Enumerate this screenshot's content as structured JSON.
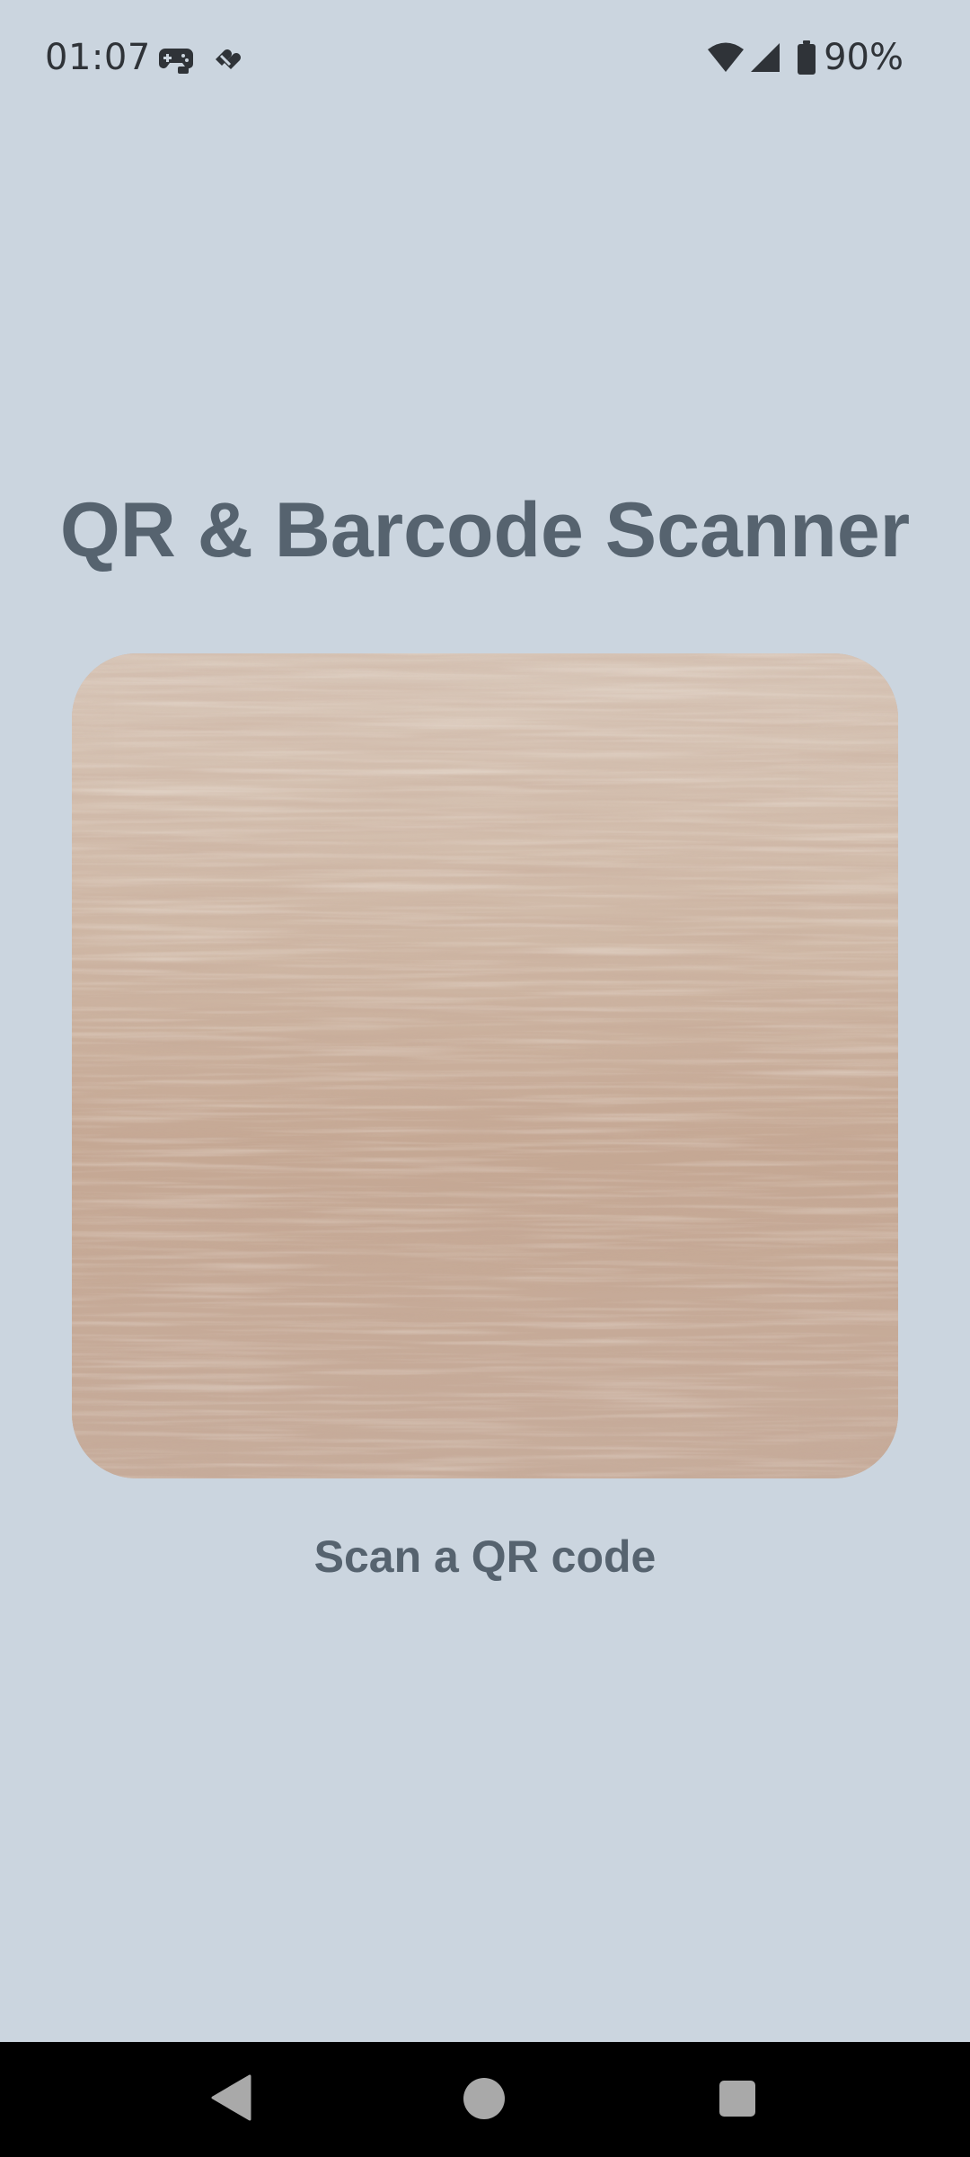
{
  "status_bar": {
    "time": "01:07",
    "notification_icons": [
      "game-controller-icon",
      "health-app-icon"
    ],
    "system_icons": [
      "wifi-icon",
      "cell-signal-icon",
      "battery-icon"
    ],
    "battery_text": "90%",
    "battery_level": 0.9
  },
  "main": {
    "title": "QR & Barcode Scanner",
    "camera_preview": {
      "content": "live camera feed"
    },
    "scan_prompt": "Scan a QR code"
  },
  "navigation_bar": {
    "buttons": [
      "back-icon",
      "home-icon",
      "recents-icon"
    ]
  },
  "colors": {
    "background": "#cbd5df",
    "text_primary": "#56636f",
    "status_text": "#2f3338",
    "nav_bar": "#000000",
    "nav_icons": "#a9a9a9"
  }
}
